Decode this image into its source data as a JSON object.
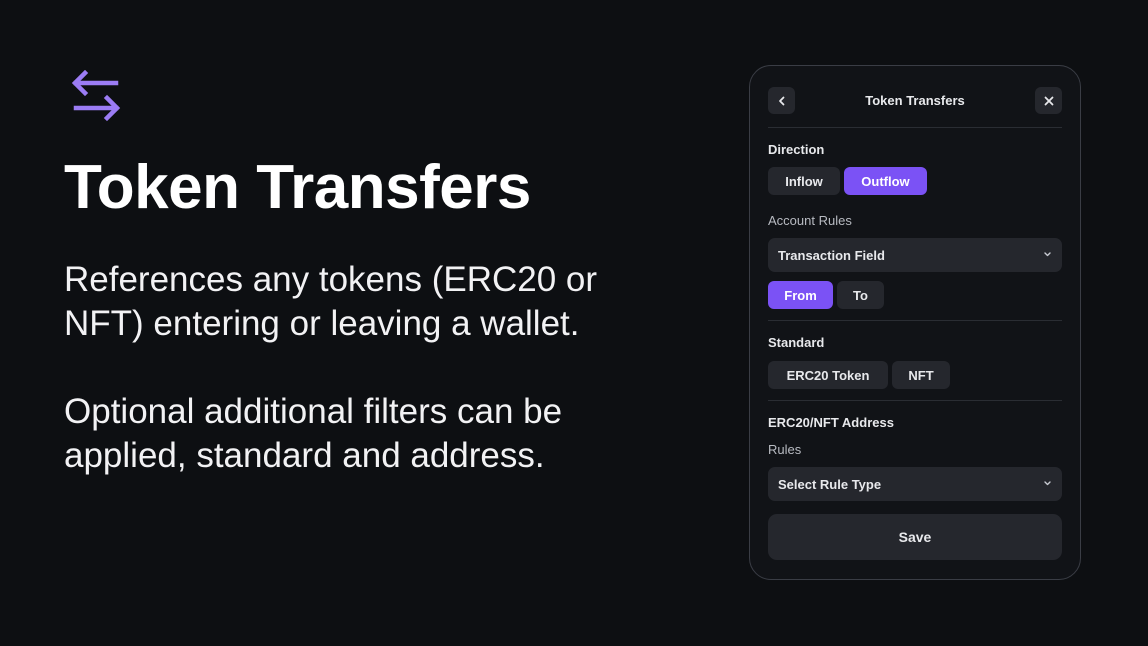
{
  "hero": {
    "icon": "transfer-arrows-icon",
    "title": "Token Transfers",
    "paragraph1": "References any tokens (ERC20 or NFT) entering or leaving a wallet.",
    "paragraph2": "Optional additional filters can be applied, standard and address."
  },
  "panel": {
    "title": "Token Transfers",
    "back_icon": "chevron-left-icon",
    "close_icon": "close-icon",
    "direction": {
      "label": "Direction",
      "options": [
        "Inflow",
        "Outflow"
      ],
      "selected": "Outflow"
    },
    "account_rules": {
      "label": "Account Rules",
      "select_value": "Transaction Field",
      "options": [
        "From",
        "To"
      ],
      "selected": "From"
    },
    "standard": {
      "label": "Standard",
      "options": [
        "ERC20 Token",
        "NFT"
      ]
    },
    "address": {
      "label": "ERC20/NFT Address",
      "rules_label": "Rules",
      "select_value": "Select Rule Type"
    },
    "save_label": "Save"
  },
  "colors": {
    "background": "#0d0f12",
    "accent": "#7b52f5",
    "icon_accent": "#9b7cf4",
    "control": "#25272d"
  }
}
